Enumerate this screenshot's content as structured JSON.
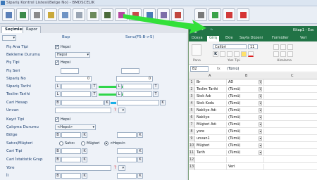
{
  "window": {
    "title": "Sipariş Kontrol Listesi(Belge No) - BMDSCELIK"
  },
  "tabs": [
    {
      "label": "Seçimler"
    },
    {
      "label": "Rapor"
    }
  ],
  "headers": {
    "basi": "Başı",
    "sonu": "Sonu(F5:B->S)"
  },
  "form": {
    "fis_ana_tipi": {
      "label": "Fiş Ana Tipi",
      "check_label": "Hepsi"
    },
    "bekleme_durumu": {
      "label": "Bekleme Durumu",
      "value": "Hepsi"
    },
    "fis_tipi": {
      "label": "Fiş Tipi",
      "check_label": "Hepsi"
    },
    "fis_seri": {
      "label": "Fiş Seri"
    },
    "siparis_no": {
      "label": "Sipariş No",
      "from": "0",
      "to": "0"
    },
    "siparis_tarihi": {
      "label": "Sipariş Tarihi",
      "l": "L",
      "t": "T"
    },
    "teslim_tarihi": {
      "label": "Teslim Tarihi",
      "l": "L",
      "t": "T"
    },
    "cari_hesap": {
      "label": "Cari Hesap",
      "b": "B",
      "k": "K"
    },
    "unvan": {
      "label": "Unvan",
      "q": "?"
    },
    "kayit_tipi": {
      "label": "Kayıt Tipi",
      "check_label": "Hepsi"
    },
    "calisma_durumu": {
      "label": "Çalışma Durumu",
      "value": "<Hepsi>"
    },
    "bolge": {
      "label": "Bölge",
      "b": "B",
      "k": "K"
    },
    "satici_musteri": {
      "label": "Satıcı/Müşteri",
      "opt1": "Satıcı",
      "opt2": "Müşteri",
      "opt3": "<Hepsi>"
    },
    "cari_tipi": {
      "label": "Cari Tipi",
      "b": "B",
      "k": "K"
    },
    "cari_istatistik_grup": {
      "label": "Cari İstatistik Grup",
      "b": "B",
      "k": "K"
    },
    "yore": {
      "label": "Yöre",
      "q": "?"
    },
    "il": {
      "label": "İl",
      "b": "B",
      "k": "K"
    }
  },
  "excel": {
    "title": "Kitap1 - Exc",
    "tabs": [
      "Dosya",
      "Giriş",
      "Ekle",
      "Sayfa Düzeni",
      "Formüller",
      "Veri"
    ],
    "ribbon": {
      "font": "Calibri",
      "size": "11",
      "groups": [
        "Pano",
        "Yazı Tipi",
        "Hizalama"
      ]
    },
    "cell_ref": "B2",
    "formula": "(Tümü)",
    "col_headers": [
      "A",
      "B",
      "C"
    ],
    "rows": [
      {
        "n": "1",
        "a": "Br",
        "b": "AD",
        "filter": false
      },
      {
        "n": "2",
        "a": "Teslim Tarihi",
        "b": "(Tümü)",
        "filter": true
      },
      {
        "n": "3",
        "a": "Stok Adı",
        "b": "(Tümü)",
        "filter": true
      },
      {
        "n": "4",
        "a": "Stok Kodu",
        "b": "(Tümü)",
        "filter": true
      },
      {
        "n": "5",
        "a": "Nakliye Adı",
        "b": "(Tümü)",
        "filter": true
      },
      {
        "n": "6",
        "a": "Nakliye",
        "b": "(Tümü)",
        "filter": true
      },
      {
        "n": "7",
        "a": "Müşteri Adı",
        "b": "(Tümü)",
        "filter": true
      },
      {
        "n": "8",
        "a": "yore",
        "b": "(Tümü)",
        "filter": true
      },
      {
        "n": "9",
        "a": "unvan1",
        "b": "(Tümü)",
        "filter": true
      },
      {
        "n": "10",
        "a": "Müşteri",
        "b": "(Tümü)",
        "filter": true
      },
      {
        "n": "11",
        "a": "Tarih",
        "b": "(Tümü)",
        "filter": true
      },
      {
        "n": "12",
        "a": "",
        "b": "",
        "filter": false
      },
      {
        "n": "13",
        "a": "",
        "b": "Veri",
        "filter": false
      }
    ]
  },
  "colors": {
    "green": "#2fd64a",
    "excel": "#217346",
    "blue": "#1ab0e8"
  }
}
